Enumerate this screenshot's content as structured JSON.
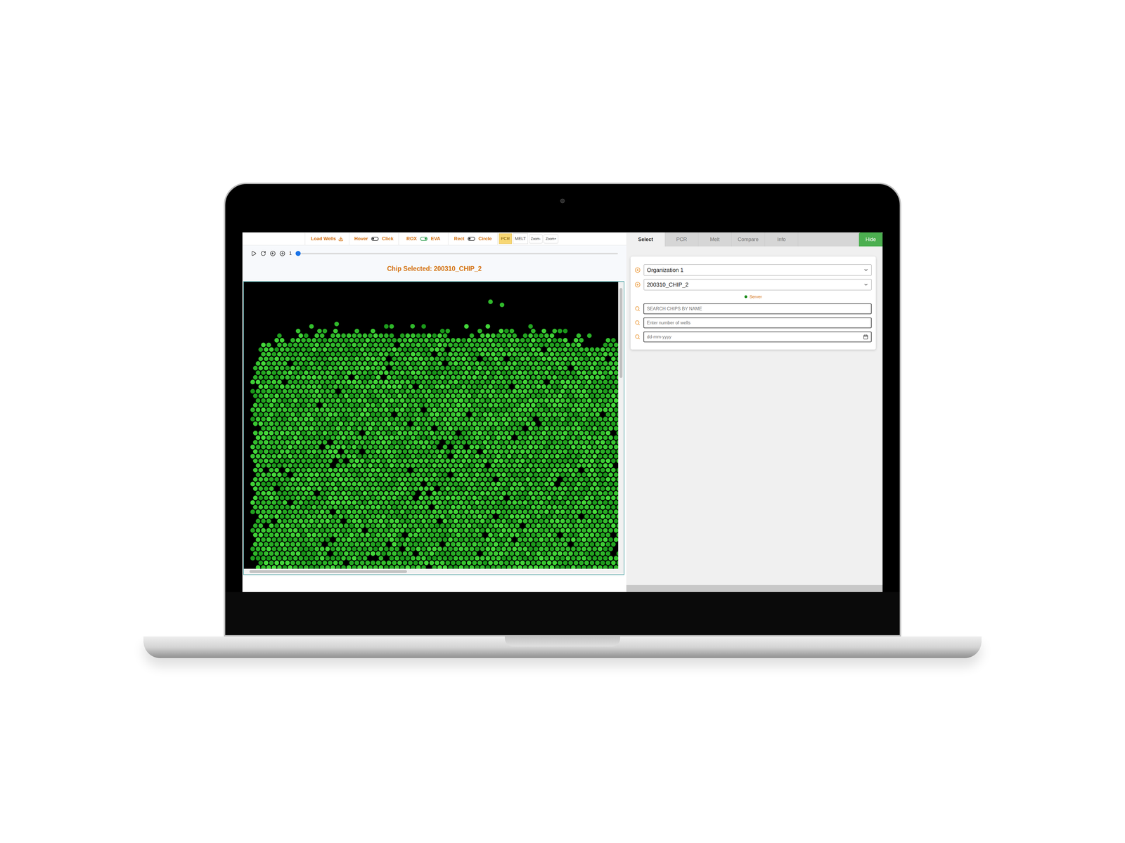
{
  "toolbar": {
    "load": {
      "label": "Load Wells"
    },
    "toggles": [
      {
        "left": "Hover",
        "right": "Click",
        "on": false
      },
      {
        "left": "ROX",
        "right": "EVA",
        "on": true
      },
      {
        "left": "Rect",
        "right": "Circle",
        "on": false
      }
    ],
    "modes": [
      {
        "label": "PCR",
        "selected": true
      },
      {
        "label": "MELT",
        "selected": false
      }
    ],
    "zoom": [
      "Zoom-",
      "Zoom+"
    ]
  },
  "player": {
    "frame": "1",
    "level": 0
  },
  "chip_title": "Chip Selected: 200310_CHIP_2",
  "tabs": [
    {
      "label": "Select",
      "selected": true
    },
    {
      "label": "PCR",
      "selected": false
    },
    {
      "label": "Melt",
      "selected": false
    },
    {
      "label": "Compare",
      "selected": false
    },
    {
      "label": "Info",
      "selected": false
    }
  ],
  "hide_button": "Hide",
  "selects": [
    "Organization 1",
    "200310_CHIP_2"
  ],
  "status": {
    "label": "Server",
    "color": "#1a8a1a"
  },
  "inputs": [
    {
      "placeholder": "SEARCH CHIPS BY NAME",
      "kind": "text"
    },
    {
      "placeholder": "Enter number of wells",
      "kind": "text"
    },
    {
      "placeholder": "dd-mm-yyyy",
      "kind": "date"
    }
  ]
}
